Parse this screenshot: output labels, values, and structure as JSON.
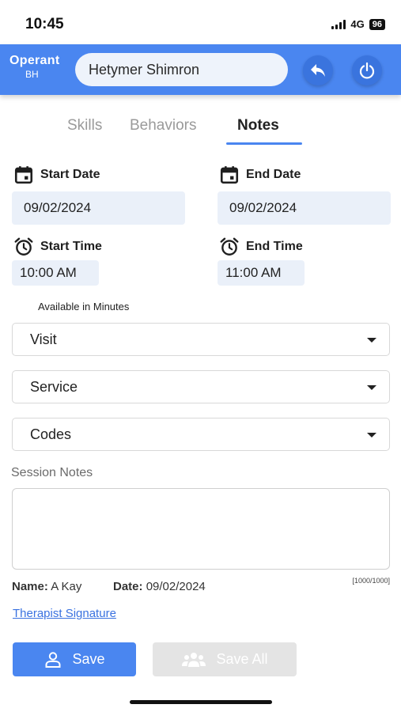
{
  "status_bar": {
    "time": "10:45",
    "network": "4G",
    "battery": "96"
  },
  "header": {
    "logo_top": "Operant",
    "logo_bottom": "BH",
    "client_name": "Hetymer Shimron",
    "back_icon": "reply-arrow-icon",
    "power_icon": "power-icon",
    "accent_color": "#4a86f0"
  },
  "tabs": [
    {
      "label": "Skills",
      "active": false
    },
    {
      "label": "Behaviors",
      "active": false
    },
    {
      "label": "Notes",
      "active": true
    }
  ],
  "dates": {
    "start_label": "Start Date",
    "start_value": "09/02/2024",
    "end_label": "End Date",
    "end_value": "09/02/2024"
  },
  "times": {
    "start_label": "Start Time",
    "start_value": "10:00 AM",
    "end_label": "End Time",
    "end_value": "11:00 AM"
  },
  "available_label": "Available in Minutes",
  "dropdowns": {
    "visit": "Visit",
    "service": "Service",
    "codes": "Codes"
  },
  "session_notes": {
    "label": "Session Notes",
    "value": "",
    "char_count": "[1000/1000]"
  },
  "meta": {
    "name_label": "Name:",
    "name_value": "A Kay",
    "date_label": "Date:",
    "date_value": "09/02/2024"
  },
  "signature_link": "Therapist Signature",
  "buttons": {
    "save": "Save",
    "save_all": "Save All"
  }
}
